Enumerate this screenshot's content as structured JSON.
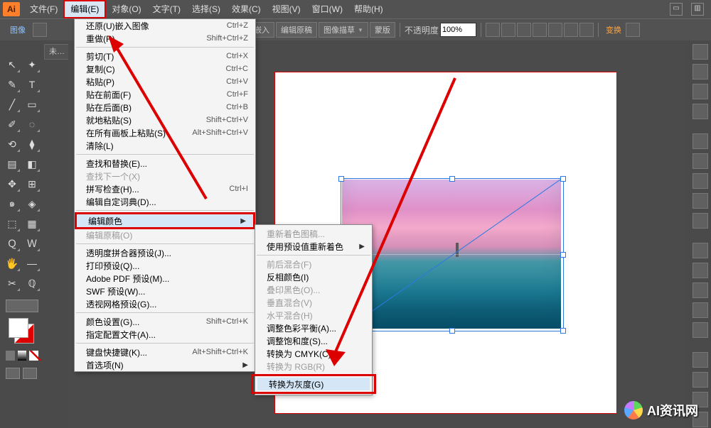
{
  "app": {
    "logo": "Ai"
  },
  "menu": {
    "items": [
      "文件(F)",
      "编辑(E)",
      "对象(O)",
      "文字(T)",
      "选择(S)",
      "效果(C)",
      "视图(V)",
      "窗口(W)",
      "帮助(H)"
    ],
    "active_index": 1
  },
  "options": {
    "tab": "图像",
    "doc_tab": "未…",
    "btn1": "嵌入",
    "btn2": "编辑原稿",
    "btn3": "图像描草",
    "btn4": "蒙版",
    "opacity_label": "不透明度",
    "opacity_value": "100%",
    "transform_link": "变换",
    "align_icons": 7
  },
  "edit_menu": {
    "g1": [
      {
        "l": "还原(U)嵌入图像",
        "s": "Ctrl+Z"
      },
      {
        "l": "重做(R)",
        "s": "Shift+Ctrl+Z"
      }
    ],
    "g2": [
      {
        "l": "剪切(T)",
        "s": "Ctrl+X"
      },
      {
        "l": "复制(C)",
        "s": "Ctrl+C"
      },
      {
        "l": "粘贴(P)",
        "s": "Ctrl+V"
      },
      {
        "l": "贴在前面(F)",
        "s": "Ctrl+F"
      },
      {
        "l": "贴在后面(B)",
        "s": "Ctrl+B"
      },
      {
        "l": "就地粘贴(S)",
        "s": "Shift+Ctrl+V"
      },
      {
        "l": "在所有画板上粘贴(S)",
        "s": "Alt+Shift+Ctrl+V"
      },
      {
        "l": "清除(L)",
        "s": ""
      }
    ],
    "g3": [
      {
        "l": "查找和替换(E)...",
        "s": ""
      },
      {
        "l": "查找下一个(X)",
        "s": "",
        "dis": true
      },
      {
        "l": "拼写检查(H)...",
        "s": "Ctrl+I"
      },
      {
        "l": "编辑自定词典(D)...",
        "s": ""
      }
    ],
    "g4": [
      {
        "l": "编辑颜色",
        "s": "",
        "sub": true,
        "hl": true
      },
      {
        "l": "编辑原稿(O)",
        "s": "",
        "dis": true
      }
    ],
    "g5": [
      {
        "l": "透明度拼合器预设(J)...",
        "s": ""
      },
      {
        "l": "打印预设(Q)...",
        "s": ""
      },
      {
        "l": "Adobe PDF 预设(M)...",
        "s": ""
      },
      {
        "l": "SWF 预设(W)...",
        "s": ""
      },
      {
        "l": "透视网格预设(G)...",
        "s": ""
      }
    ],
    "g6": [
      {
        "l": "颜色设置(G)...",
        "s": "Shift+Ctrl+K"
      },
      {
        "l": "指定配置文件(A)...",
        "s": ""
      }
    ],
    "g7": [
      {
        "l": "键盘快捷键(K)...",
        "s": "Alt+Shift+Ctrl+K"
      },
      {
        "l": "首选项(N)",
        "s": "",
        "sub": true
      }
    ]
  },
  "color_submenu": {
    "g1": [
      {
        "l": "重新着色图稿...",
        "dis": true
      },
      {
        "l": "使用预设值重新着色",
        "sub": true
      }
    ],
    "g2": [
      {
        "l": "前后混合(F)",
        "dis": true
      },
      {
        "l": "反相颜色(I)"
      },
      {
        "l": "叠印黑色(O)...",
        "dis": true
      },
      {
        "l": "垂直混合(V)",
        "dis": true
      },
      {
        "l": "水平混合(H)",
        "dis": true
      },
      {
        "l": "调整色彩平衡(A)..."
      },
      {
        "l": "调整饱和度(S)..."
      },
      {
        "l": "转换为 CMYK(C)"
      },
      {
        "l": "转换为 RGB(R)",
        "dis": true
      },
      {
        "l": "转换为灰度(G)",
        "hl": true
      }
    ]
  },
  "tools": [
    "↖",
    "✦",
    "✎",
    "T",
    "╱",
    "▭",
    "✐",
    "◌",
    "⟲",
    "⧫",
    "▤",
    "◧",
    "✥",
    "⊞",
    "๑",
    "◈",
    "⬚",
    "▦",
    "Ｑ",
    "Ｗ",
    "🖐",
    "—",
    "✂",
    "ℚ"
  ],
  "right_dock_count": 18,
  "watermark": "AI资讯网"
}
